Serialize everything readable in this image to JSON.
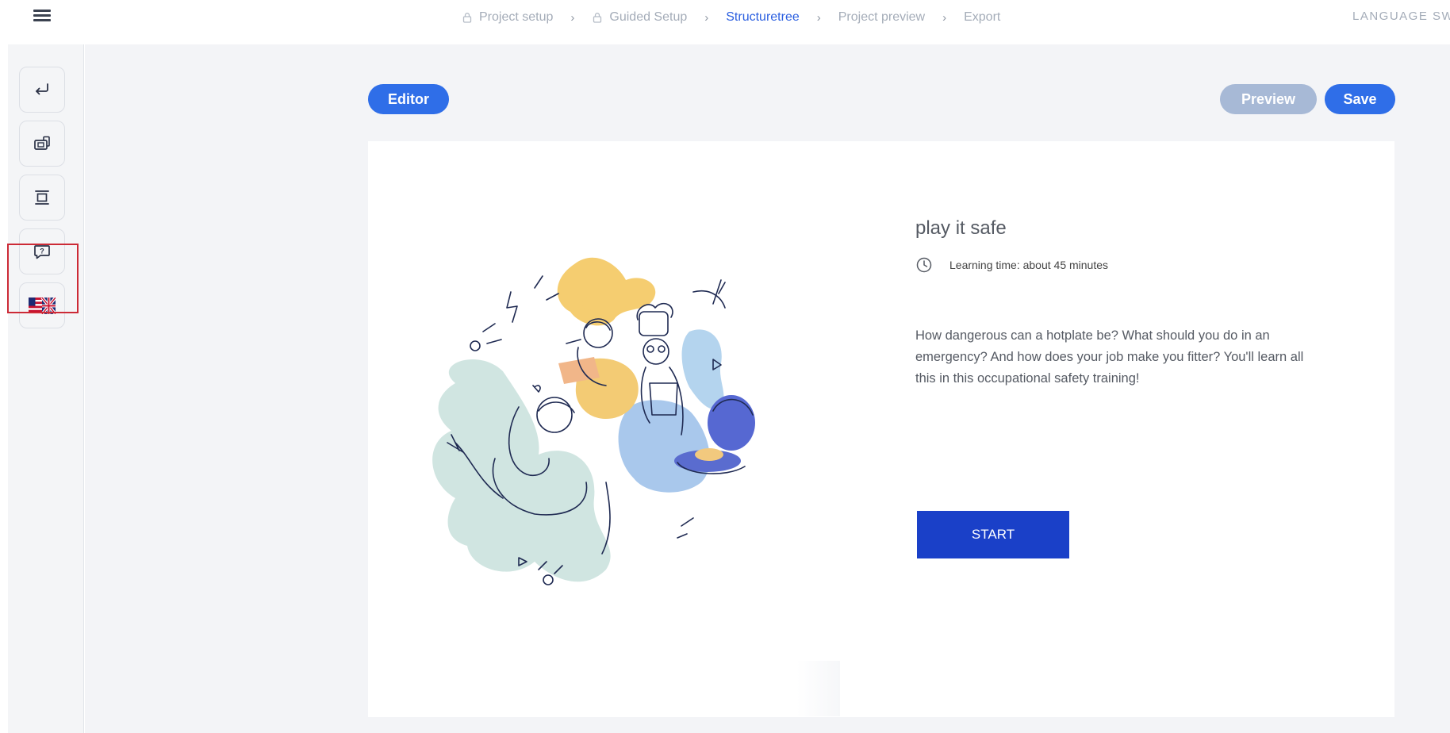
{
  "topbar": {
    "menu_icon": "hamburger-icon",
    "breadcrumb": [
      {
        "label": "Project setup",
        "locked": true,
        "active": false
      },
      {
        "label": "Guided Setup",
        "locked": true,
        "active": false
      },
      {
        "label": "Structuretree",
        "locked": false,
        "active": true
      },
      {
        "label": "Project preview",
        "locked": false,
        "active": false
      },
      {
        "label": "Export",
        "locked": false,
        "active": false
      }
    ],
    "language_switch": "LANGUAGE SW"
  },
  "sidebar": {
    "buttons": [
      {
        "icon": "return-arrow-icon"
      },
      {
        "icon": "media-slide-icon"
      },
      {
        "icon": "page-layout-icon"
      },
      {
        "icon": "question-bubble-icon"
      },
      {
        "icon": "us-uk-flag-icon"
      }
    ]
  },
  "toolbar": {
    "editor_label": "Editor",
    "preview_label": "Preview",
    "save_label": "Save"
  },
  "course": {
    "title": "play it safe",
    "learning_time": "Learning time: about 45 minutes",
    "description": "How dangerous can a hotplate be? What should you do in an emergency? And how does your job make you fitter? You'll learn all this in this occupational safety training!",
    "start_label": "START"
  },
  "colors": {
    "accent": "#2f6ee8",
    "active_crumb": "#2b5fe0",
    "preview_disabled": "#a7b9d6",
    "start_button": "#1a40c8",
    "annotation_red": "#cc2a36"
  }
}
